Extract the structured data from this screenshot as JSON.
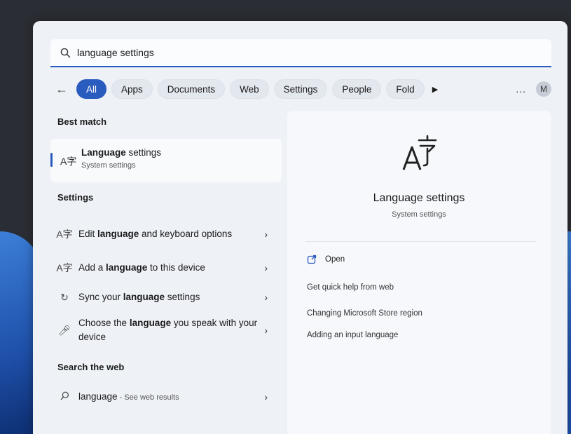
{
  "search": {
    "query": "language settings",
    "icon": "search-icon"
  },
  "filters": {
    "chips": [
      "All",
      "Apps",
      "Documents",
      "Web",
      "Settings",
      "People",
      "Fold"
    ],
    "active": "All",
    "more": "...",
    "avatar_initial": "M"
  },
  "left": {
    "best_match_title": "Best match",
    "best_match": {
      "title_bold": "Language",
      "title_rest": " settings",
      "subtitle": "System settings"
    },
    "settings_title": "Settings",
    "settings_items": [
      {
        "pre": "Edit ",
        "bold": "language",
        "post": " and keyboard options"
      },
      {
        "pre": "Add a ",
        "bold": "language",
        "post": " to this device"
      },
      {
        "pre": "Sync your ",
        "bold": "language",
        "post": " settings"
      },
      {
        "pre": "Choose the ",
        "bold": "language",
        "post": " you speak with your device"
      }
    ],
    "web_title": "Search the web",
    "web_item": {
      "term": "language",
      "sub": " - See web results"
    }
  },
  "right": {
    "title": "Language settings",
    "subtitle": "System settings",
    "open_label": "Open",
    "links": [
      "Get quick help from web",
      "Changing Microsoft Store region",
      "Adding an input language"
    ]
  },
  "colors": {
    "accent": "#2a5bbf",
    "panel_bg": "#eef1f6"
  }
}
